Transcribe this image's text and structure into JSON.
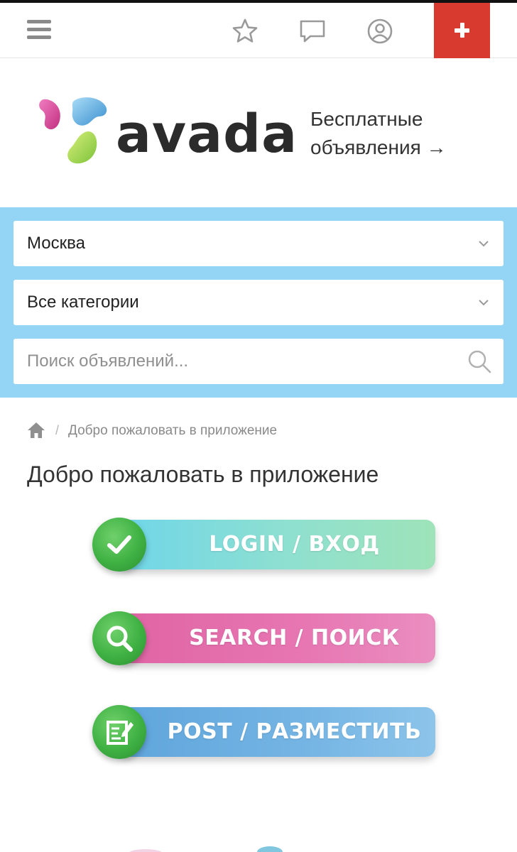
{
  "header": {
    "menu_icon": "hamburger-menu-icon",
    "favorites_icon": "star-icon",
    "messages_icon": "chat-bubble-icon",
    "account_icon": "user-circle-icon",
    "add_icon": "plus-icon",
    "add_color": "#d93a2f"
  },
  "logo": {
    "text": "avada",
    "tagline_line1": "Бесплатные",
    "tagline_line2": "объявления →"
  },
  "search": {
    "panel_color": "#94d5f6",
    "city": "Москва",
    "category": "Все категории",
    "query_placeholder": "Поиск объявлений..."
  },
  "breadcrumb": {
    "separator": "/",
    "current": "Добро пожаловать в приложение"
  },
  "page": {
    "title": "Добро пожаловать в приложение"
  },
  "actions": {
    "login_label": "LOGIN / ВХОД",
    "search_label": "SEARCH / ПОИСК",
    "post_label": "POST / РАЗМЕСТИТЬ"
  }
}
